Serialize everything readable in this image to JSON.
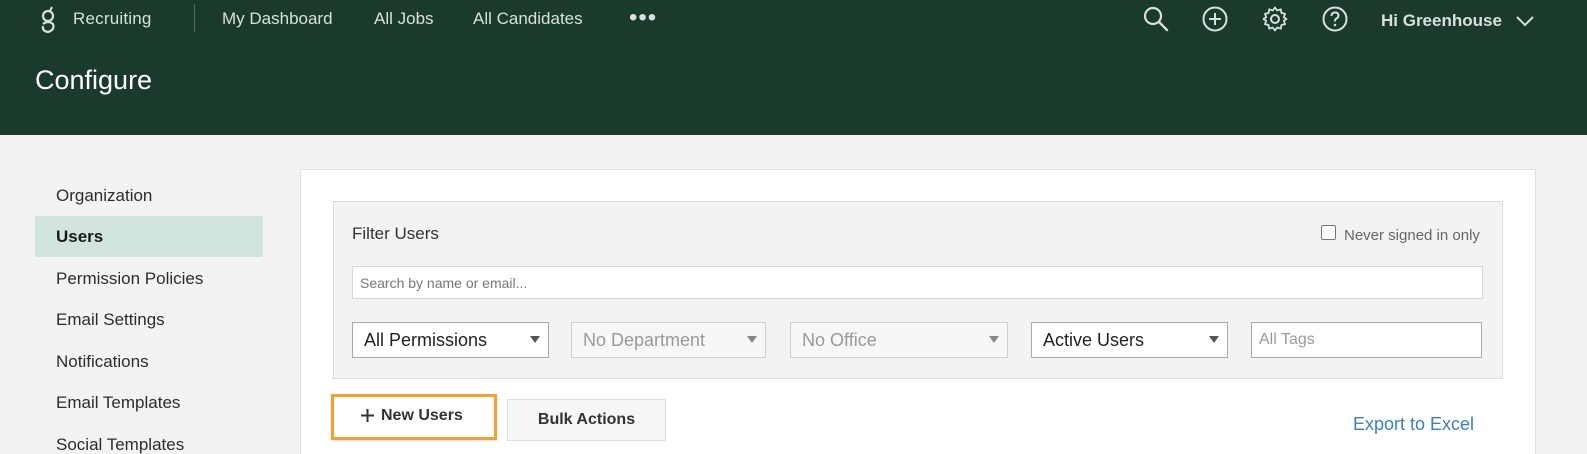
{
  "header": {
    "brand": "Recruiting",
    "nav": [
      "My Dashboard",
      "All Jobs",
      "All Candidates"
    ],
    "more": "•••",
    "icons": [
      "search-icon",
      "add-circle-icon",
      "gear-icon",
      "help-icon"
    ],
    "greeting": "Hi Greenhouse",
    "page_title": "Configure"
  },
  "sidebar": {
    "items": [
      {
        "label": "Organization"
      },
      {
        "label": "Users"
      },
      {
        "label": "Permission Policies"
      },
      {
        "label": "Email Settings"
      },
      {
        "label": "Notifications"
      },
      {
        "label": "Email Templates"
      },
      {
        "label": "Social Templates"
      }
    ],
    "active": "Users"
  },
  "filters": {
    "title": "Filter Users",
    "never_signed_in_label": "Never signed in only",
    "search_placeholder": "Search by name or email...",
    "permissions": "All Permissions",
    "department": "No Department",
    "office": "No Office",
    "status": "Active Users",
    "tags_placeholder": "All Tags"
  },
  "actions": {
    "new_users": "New Users",
    "bulk_actions": "Bulk Actions",
    "export": "Export to Excel"
  },
  "colors": {
    "header_bg": "#1a3a2e",
    "active_item_bg": "#d1e4de",
    "highlight": "#f5a033",
    "link": "#3b7fc4"
  }
}
